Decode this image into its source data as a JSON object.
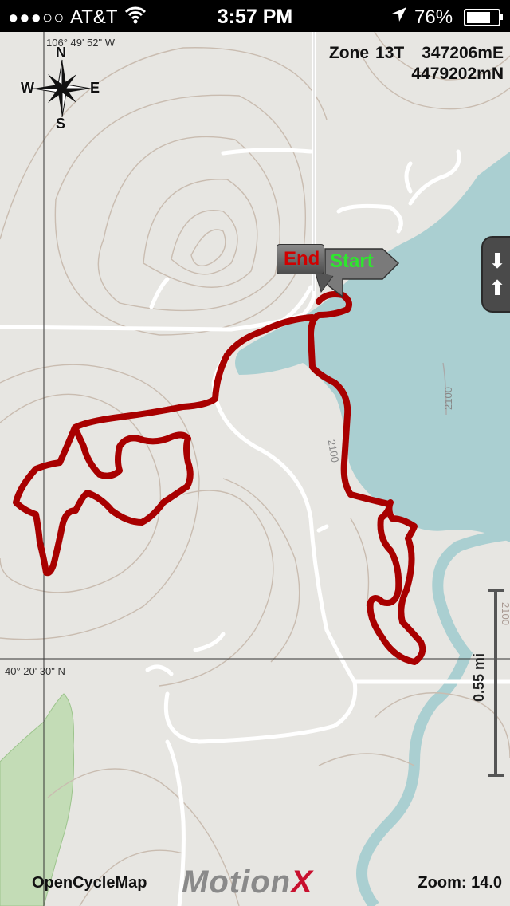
{
  "status_bar": {
    "signal": "●●●○○",
    "carrier": "AT&T",
    "time": "3:57 PM",
    "battery_percent": "76%",
    "battery_level": 0.76
  },
  "map": {
    "longitude_label": "106° 49' 52\" W",
    "latitude_label": "40° 20' 30\" N",
    "compass": {
      "n": "N",
      "s": "S",
      "e": "E",
      "w": "W"
    },
    "zone_label": "Zone",
    "zone_value": "13T",
    "easting": "347206mE",
    "northing": "4479202mN",
    "elevation_label_1": "2100",
    "elevation_label_2": "2100",
    "elevation_label_3": "2100",
    "pin_end": "End",
    "pin_start": "Start",
    "scale_label": "0.55 mi",
    "attribution": "OpenCycleMap",
    "brand_main": "Motion",
    "brand_x": "X",
    "zoom": "Zoom: 14.0",
    "colors": {
      "track": "#a80000",
      "water": "#aacfd1",
      "forest": "#c3dcb6",
      "background": "#e7e6e2"
    }
  }
}
